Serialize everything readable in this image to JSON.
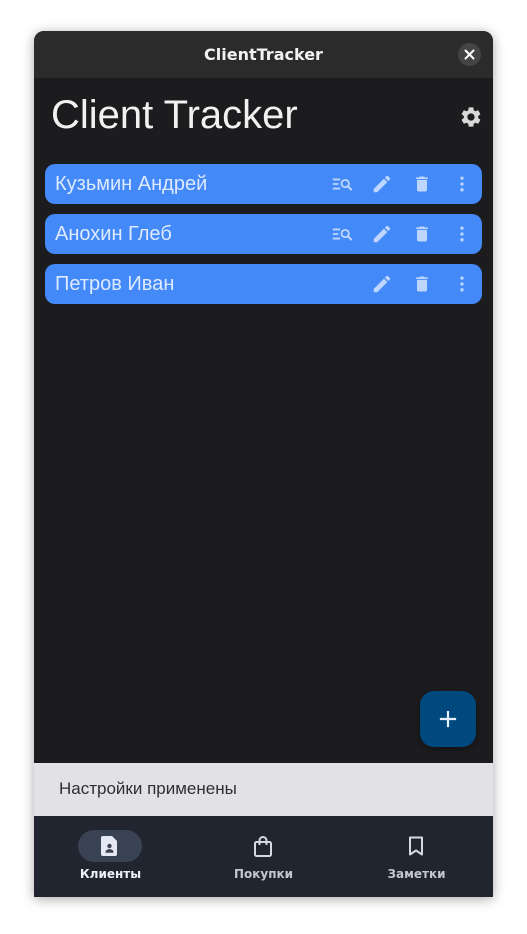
{
  "window": {
    "title": "ClientTracker",
    "close_icon": "close-icon"
  },
  "app": {
    "title": "Client Tracker",
    "settings_icon": "gear-icon"
  },
  "clients": [
    {
      "name": "Кузьмин Андрей",
      "actions": [
        "search-list-icon",
        "edit-icon",
        "delete-icon",
        "more-vert-icon"
      ]
    },
    {
      "name": "Анохин Глеб",
      "actions": [
        "search-list-icon",
        "edit-icon",
        "delete-icon",
        "more-vert-icon"
      ]
    },
    {
      "name": "Петров Иван",
      "actions": [
        "edit-icon",
        "delete-icon",
        "more-vert-icon"
      ]
    }
  ],
  "fab": {
    "icon": "plus-icon"
  },
  "snackbar": {
    "text": "Настройки применены"
  },
  "bottom_nav": {
    "items": [
      {
        "label": "Клиенты",
        "icon": "contact-page-icon",
        "selected": true
      },
      {
        "label": "Покупки",
        "icon": "shopping-bag-icon",
        "selected": false
      },
      {
        "label": "Заметки",
        "icon": "bookmark-icon",
        "selected": false
      }
    ]
  },
  "colors": {
    "window_bg": "#1c1c1e",
    "titlebar_bg": "#2b2b2b",
    "client_item_bg": "#4489f8",
    "client_text": "#ddeaff",
    "fab_bg": "#00497e",
    "snackbar_bg": "#e2e2e6",
    "bottom_nav_bg": "#212530",
    "nav_active_bg": "#394354"
  }
}
